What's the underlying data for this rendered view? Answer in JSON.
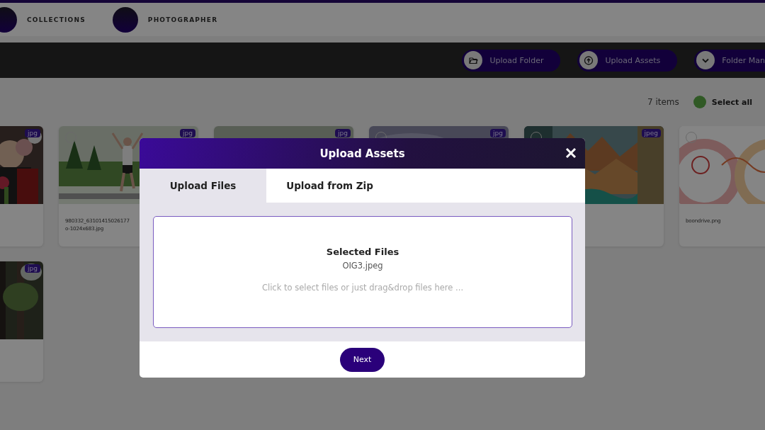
{
  "top_nav": {
    "links": [
      {
        "label": "COLLECTIONS"
      },
      {
        "label": "PHOTOGRAPHER"
      }
    ]
  },
  "toolbar": {
    "buttons": [
      {
        "label": "Upload Folder",
        "kind": "folder"
      },
      {
        "label": "Upload Assets",
        "kind": "upload"
      },
      {
        "label": "Folder Man",
        "kind": "dropdown"
      }
    ]
  },
  "summary": {
    "count": "7 items",
    "select_all": "Select all"
  },
  "asset_rows": [
    [
      {
        "kind": "picture",
        "badge": "jpg"
      },
      {
        "kind": "picture",
        "badge": "jpg",
        "checked": false,
        "filename_lines": [
          "980332_63101415026177",
          "o-1024x683.jpg"
        ]
      },
      {
        "kind": "picture",
        "badge": "jpg"
      },
      {
        "kind": "picture",
        "badge": "jpg",
        "checked": false
      },
      {
        "kind": "picture",
        "badge": "jpeg",
        "checked": false
      },
      {
        "kind": "picture",
        "checked": false,
        "filename_lines": [
          "boondrive.png"
        ]
      }
    ],
    [
      {
        "kind": "picture",
        "badge": "jpg"
      }
    ]
  ],
  "modal": {
    "title": "Upload Assets",
    "tabs": [
      {
        "label": "Upload Files",
        "selected": true
      },
      {
        "label": "Upload from Zip",
        "selected": false
      }
    ],
    "dropzone": {
      "heading": "Selected Files",
      "files": [
        "OIG3.jpeg"
      ],
      "hint": "Click to select files or just drag&drop files here ..."
    },
    "next_button": "Next"
  }
}
